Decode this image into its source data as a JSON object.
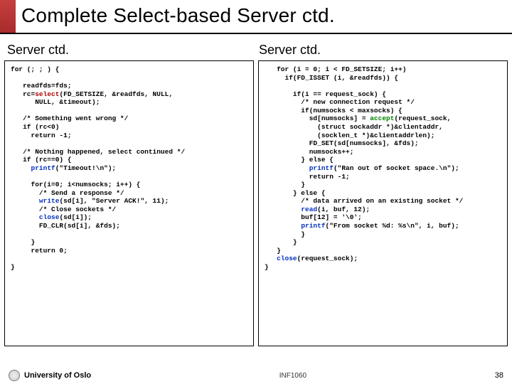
{
  "title": "Complete Select-based Server ctd.",
  "left": {
    "heading": "Server ctd.",
    "code": {
      "l1": "for (; ; ) {",
      "l2": "",
      "l3": "   readfds=fds;",
      "l4a": "   rc=",
      "l4fn": "select",
      "l4b": "(FD_SETSIZE, &readfds, NULL,",
      "l5": "      NULL, &timeout);",
      "l6": "",
      "l7": "   /* Something went wrong */",
      "l8": "   if (rc<0)",
      "l9": "     return -1;",
      "l10": "",
      "l11": "   /* Nothing happened, select continued */",
      "l12": "   if (rc==0) {",
      "l13a": "     ",
      "l13fn": "printf",
      "l13b": "(\"Timeout!\\n\");",
      "l14": "",
      "l15": "     for(i=0; i<numsocks; i++) {",
      "l16": "       /* Send a response */",
      "l17a": "       ",
      "l17fn": "write",
      "l17b": "(sd[i], \"Server ACK!\", 11);",
      "l18": "       /* Close sockets */",
      "l19a": "       ",
      "l19fn": "close",
      "l19b": "(sd[i]);",
      "l20": "       FD_CLR(sd[i], &fds);",
      "l21": "",
      "l22": "     }",
      "l23": "     return 0;",
      "l24": "",
      "l25": "}"
    }
  },
  "right": {
    "heading": "Server ctd.",
    "code": {
      "r1": "   for (i = 0; i < FD_SETSIZE; i++)",
      "r2": "     if(FD_ISSET (i, &readfds)) {",
      "r3": "",
      "r4": "       if(i == request_sock) {",
      "r5": "         /* new connection request */",
      "r6": "         if(numsocks < maxsocks) {",
      "r7a": "           sd[numsocks] = ",
      "r7fn": "accept",
      "r7b": "(request_sock,",
      "r8": "             (struct sockaddr *)&clientaddr,",
      "r9": "             (socklen_t *)&clientaddrlen);",
      "r10": "           FD_SET(sd[numsocks], &fds);",
      "r11": "           numsocks++;",
      "r12": "         } else {",
      "r13a": "           ",
      "r13fn": "printf",
      "r13b": "(\"Ran out of socket space.\\n\");",
      "r14": "           return -1;",
      "r15": "         }",
      "r16": "       } else {",
      "r17": "         /* data arrived on an existing socket */",
      "r18a": "         ",
      "r18fn": "read",
      "r18b": "(i, buf, 12);",
      "r19": "         buf[12] = '\\0';",
      "r20a": "         ",
      "r20fn": "printf",
      "r20b": "(\"From socket %d: %s\\n\", i, buf);",
      "r21": "         }",
      "r22": "       }",
      "r23": "   }",
      "r24a": "   ",
      "r24fn": "close",
      "r24b": "(request_sock);",
      "r25": "}"
    }
  },
  "footer": {
    "uni": "University of Oslo",
    "course": "INF1060",
    "page": "38"
  }
}
